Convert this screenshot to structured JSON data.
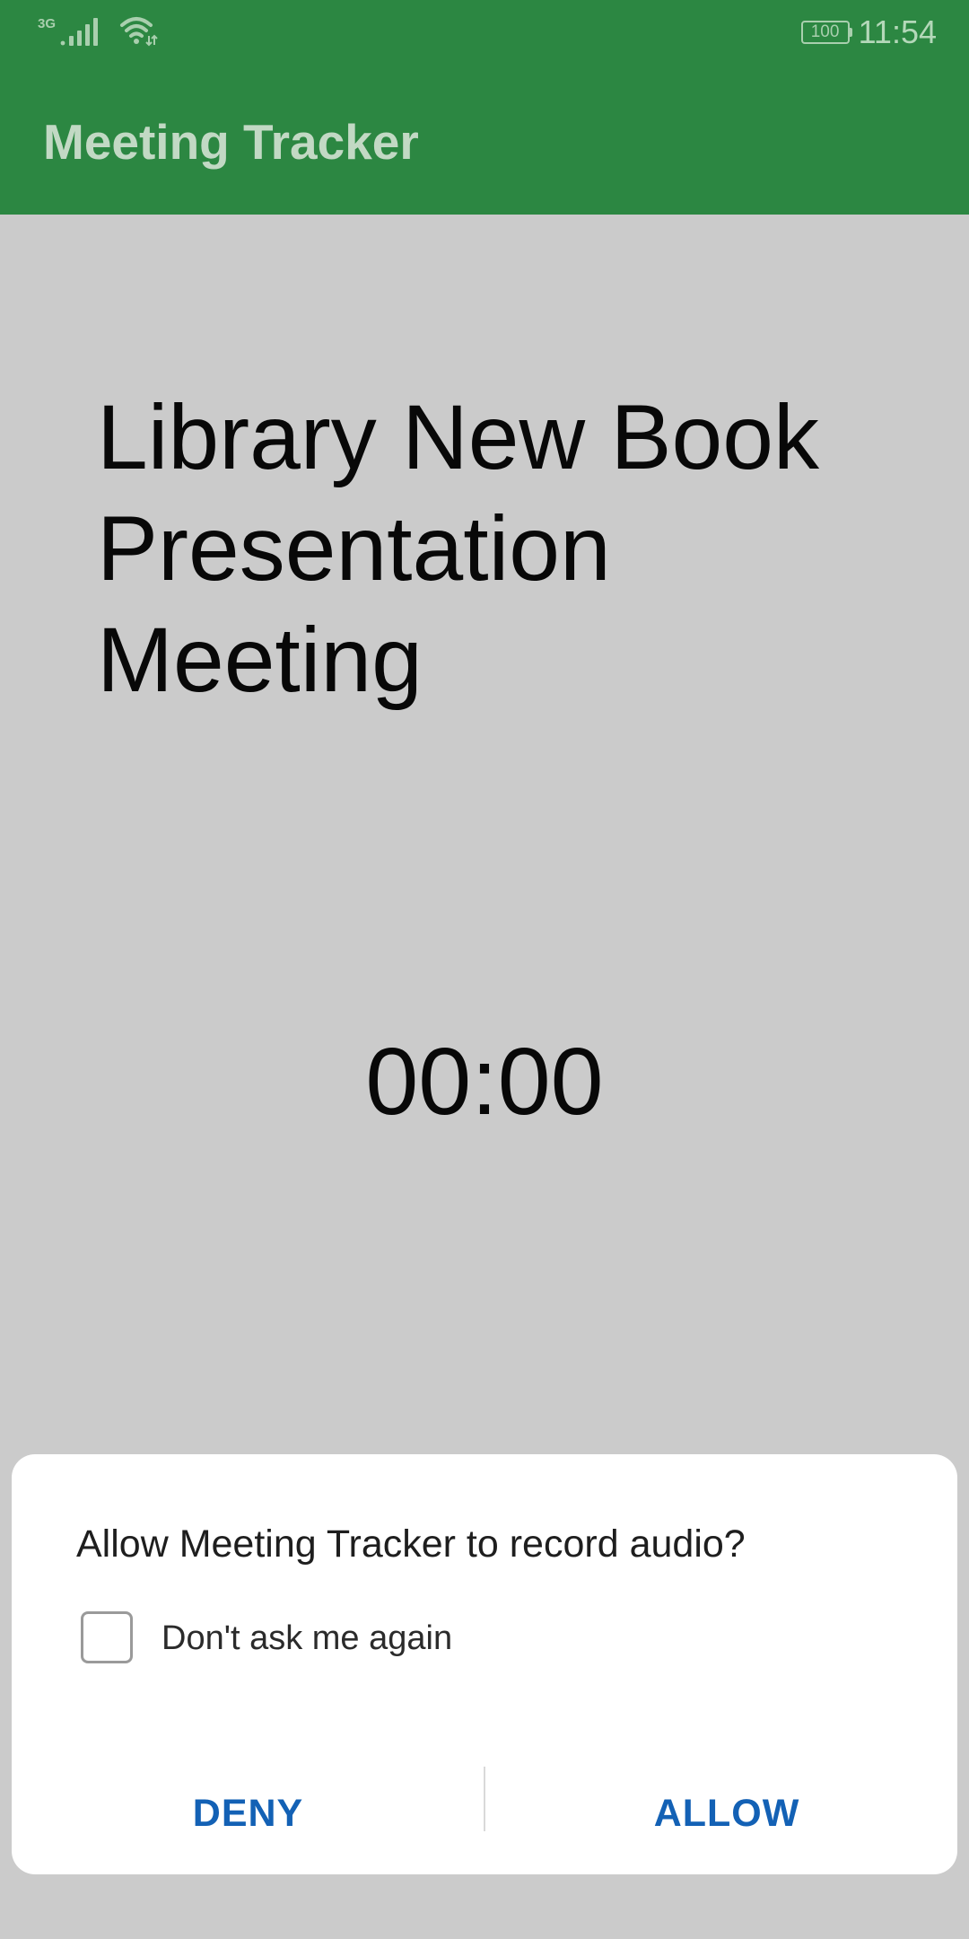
{
  "status_bar": {
    "network_type": "3G",
    "battery_level": "100",
    "time": "11:54",
    "icons": [
      "signal-icon",
      "wifi-icon",
      "battery-icon"
    ]
  },
  "app_bar": {
    "title": "Meeting Tracker",
    "color": "#2c8742"
  },
  "main": {
    "meeting_title": "Library New Book Presentation Meeting",
    "timer": "00:00"
  },
  "permission_dialog": {
    "message": "Allow Meeting Tracker to record audio?",
    "checkbox_label": "Don't ask me again",
    "checkbox_checked": false,
    "deny_label": "DENY",
    "allow_label": "ALLOW",
    "button_color": "#1361b5"
  }
}
